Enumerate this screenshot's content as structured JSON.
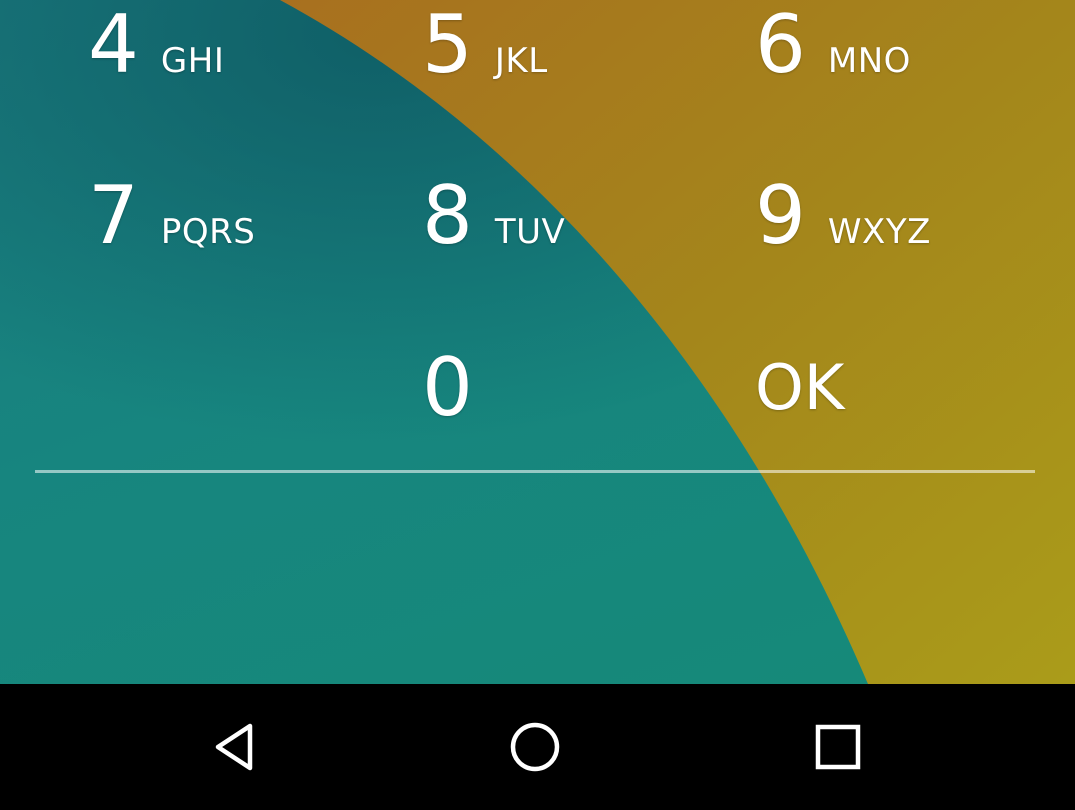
{
  "keypad": {
    "keys": [
      {
        "digit": "4",
        "letters": "GHI"
      },
      {
        "digit": "5",
        "letters": "JKL"
      },
      {
        "digit": "6",
        "letters": "MNO"
      },
      {
        "digit": "7",
        "letters": "PQRS"
      },
      {
        "digit": "8",
        "letters": "TUV"
      },
      {
        "digit": "9",
        "letters": "WXYZ"
      },
      {
        "digit": "0",
        "letters": ""
      },
      {
        "digit": "OK",
        "letters": ""
      }
    ]
  },
  "navbar": {
    "icons": [
      "back-icon",
      "home-icon",
      "recents-icon"
    ]
  },
  "colors": {
    "wallpaper_teal": "#17857f",
    "wallpaper_gold": "#a8861c",
    "navbar": "#000000",
    "text": "#ffffff"
  }
}
